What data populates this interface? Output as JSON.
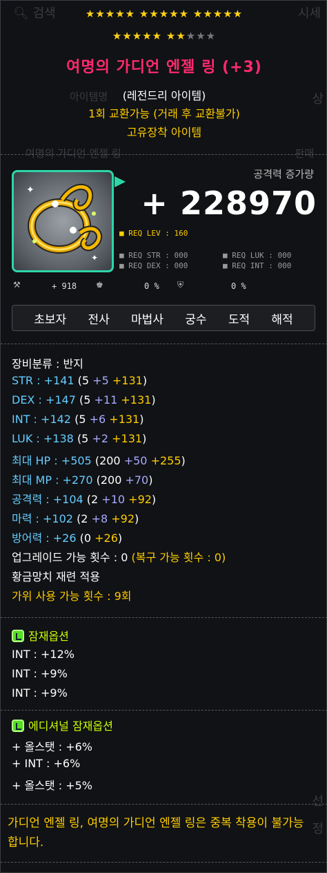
{
  "background": {
    "search": "검색",
    "market": "시세",
    "item_label": "아이템명",
    "sale_label": "판매",
    "search_item_ghost": "여명의 가디언 엔젤 링",
    "side_top": "상",
    "side_bottom_a": "선",
    "side_bottom_b": "정"
  },
  "stars_row1": "★★★★★  ★★★★★  ★★★★★",
  "stars_row2_filled": "★★★★★ ★★",
  "stars_row2_empty": "★★★",
  "item": {
    "name": "여명의 가디언 엔젤 링 (+3)",
    "grade": "(레전드리 아이템)",
    "trade": "1회 교환가능 (거래 후 교환불가)",
    "unique": "고유장착 아이템"
  },
  "attack_gain_label": "공격력 증가량",
  "attack_gain_value": "+ 228970",
  "req": {
    "lev": "■ REQ LEV : 160",
    "str": "■ REQ STR : 000",
    "luk": "■ REQ LUK : 000",
    "dex": "■ REQ DEX : 000",
    "int": "■ REQ INT : 000"
  },
  "mini": {
    "a": "+ 918",
    "b": "0 %",
    "c": "0 %"
  },
  "jobs": [
    "초보자",
    "전사",
    "마법사",
    "궁수",
    "도적",
    "해적"
  ],
  "stats": {
    "category": "장비분류 : 반지",
    "str": {
      "label": "STR : ",
      "total": "+141",
      "base": "(5 ",
      "add": "+5",
      "star": "+131",
      "close": ")"
    },
    "dex": {
      "label": "DEX : ",
      "total": "+147",
      "base": "(5 ",
      "add": "+11",
      "star": "+131",
      "close": ")"
    },
    "int": {
      "label": "INT : ",
      "total": "+142",
      "base": "(5 ",
      "add": "+6",
      "star": "+131",
      "close": ")"
    },
    "luk": {
      "label": "LUK : ",
      "total": "+138",
      "base": "(5 ",
      "add": "+2",
      "star": "+131",
      "close": ")"
    },
    "hp": {
      "label": "최대 HP : ",
      "total": "+505",
      "base": "(200 ",
      "add": "+50",
      "star": "+255",
      "close": ")"
    },
    "mp": {
      "label": "최대 MP : ",
      "total": "+270",
      "base": "(200 ",
      "add": "+70",
      "close": ")"
    },
    "atk": {
      "label": "공격력 : ",
      "total": "+104",
      "base": "(2 ",
      "add": "+10",
      "star": "+92",
      "close": ")"
    },
    "mag": {
      "label": "마력 : ",
      "total": "+102",
      "base": "(2 ",
      "add": "+8",
      "star": "+92",
      "close": ")"
    },
    "def": {
      "label": "방어력 : ",
      "total": "+26",
      "base": "(0 ",
      "star": "+26",
      "close": ")"
    },
    "upgrade": "업그레이드 가능 횟수 : 0",
    "upgrade_restore": "(복구 가능 횟수 : 0)",
    "hammer": "황금망치 재련 적용",
    "scissors": "가위 사용 가능 횟수 : 9회"
  },
  "potential": {
    "title": "잠재옵션",
    "lines": [
      "INT : +12%",
      "INT : +9%",
      "INT : +9%"
    ]
  },
  "additional": {
    "title": "에디셔널 잠재옵션",
    "lines": [
      "+ 올스탯 : +6%",
      "+ INT : +6%",
      "+ 올스탯 : +5%"
    ]
  },
  "warning": "가디언 엔젤 링, 여명의 가디언 엔젤 링은 중복 착용이 불가능합니다.",
  "colors": {
    "name": "#ff2a6e",
    "legendary_border": "#2dd6a8",
    "stat_label": "#66ccff",
    "stat_add": "#aaaaff",
    "stat_star": "#ffcc00",
    "potential_green": "#ccff00"
  }
}
